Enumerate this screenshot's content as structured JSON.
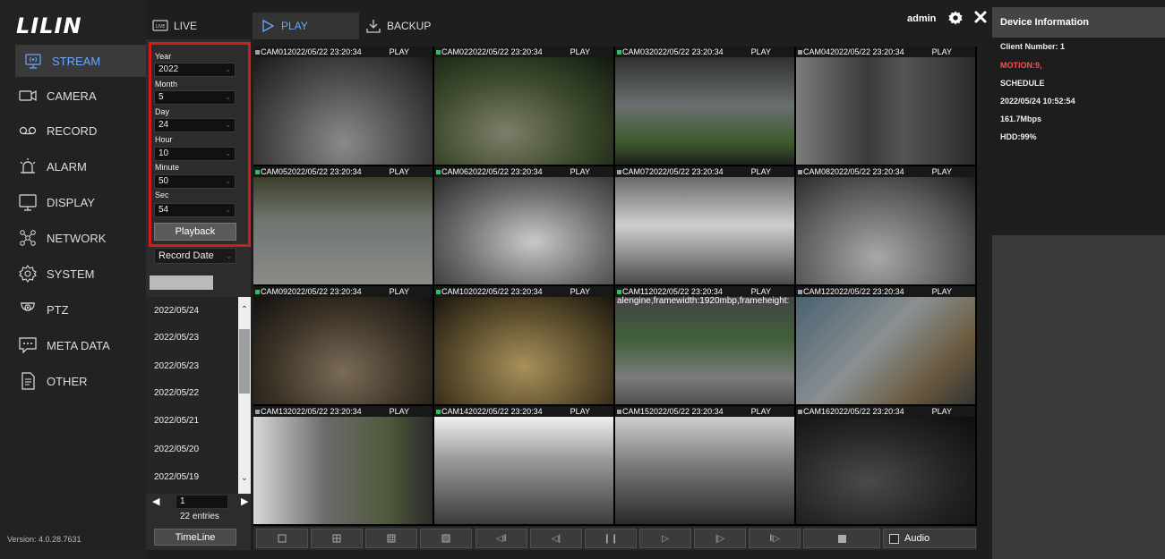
{
  "brand": {
    "logo": "LILIN"
  },
  "sidebar": {
    "items": [
      {
        "label": "STREAM",
        "icon": "stream-icon",
        "active": true
      },
      {
        "label": "CAMERA",
        "icon": "camera-icon"
      },
      {
        "label": "RECORD",
        "icon": "record-icon"
      },
      {
        "label": "ALARM",
        "icon": "alarm-icon"
      },
      {
        "label": "DISPLAY",
        "icon": "display-icon"
      },
      {
        "label": "NETWORK",
        "icon": "network-icon"
      },
      {
        "label": "SYSTEM",
        "icon": "system-icon"
      },
      {
        "label": "PTZ",
        "icon": "ptz-icon"
      },
      {
        "label": "META DATA",
        "icon": "metadata-icon"
      },
      {
        "label": "OTHER",
        "icon": "other-icon"
      }
    ],
    "version": "Version: 4.0.28.7631"
  },
  "tabs": {
    "live": "LIVE",
    "play": "PLAY",
    "backup": "BACKUP"
  },
  "header": {
    "user": "admin"
  },
  "search": {
    "year_label": "Year",
    "year": "2022",
    "month_label": "Month",
    "month": "5",
    "day_label": "Day",
    "day": "24",
    "hour_label": "Hour",
    "hour": "10",
    "minute_label": "Minute",
    "minute": "50",
    "sec_label": "Sec",
    "sec": "54",
    "playback": "Playback",
    "record_mode": "Record Date"
  },
  "date_list": [
    "2022/05/24",
    "2022/05/23",
    "2022/05/23",
    "2022/05/22",
    "2022/05/21",
    "2022/05/20",
    "2022/05/19"
  ],
  "pager": {
    "page": "1",
    "entries": "22 entries"
  },
  "timeline": "TimeLine",
  "cameras": [
    {
      "title": "CAM012022/05/22 23:20:34",
      "status": "PLAY",
      "active": false
    },
    {
      "title": "CAM022022/05/22 23:20:34",
      "status": "PLAY",
      "active": true
    },
    {
      "title": "CAM032022/05/22 23:20:34",
      "status": "PLAY",
      "active": true
    },
    {
      "title": "CAM042022/05/22 23:20:34",
      "status": "PLAY",
      "active": false
    },
    {
      "title": "CAM052022/05/22 23:20:34",
      "status": "PLAY",
      "active": true
    },
    {
      "title": "CAM062022/05/22 23:20:34",
      "status": "PLAY",
      "active": true
    },
    {
      "title": "CAM072022/05/22 23:20:34",
      "status": "PLAY",
      "active": false
    },
    {
      "title": "CAM082022/05/22 23:20:34",
      "status": "PLAY",
      "active": false
    },
    {
      "title": "CAM092022/05/22 23:20:34",
      "status": "PLAY",
      "active": true
    },
    {
      "title": "CAM102022/05/22 23:20:34",
      "status": "PLAY",
      "active": true
    },
    {
      "title": "CAM112022/05/22 23:20:34",
      "status": "PLAY",
      "active": true
    },
    {
      "title": "CAM122022/05/22 23:20:34",
      "status": "PLAY",
      "active": false
    },
    {
      "title": "CAM132022/05/22 23:20:34",
      "status": "PLAY",
      "active": false
    },
    {
      "title": "CAM142022/05/22 23:20:34",
      "status": "PLAY",
      "active": true
    },
    {
      "title": "CAM152022/05/22 23:20:34",
      "status": "PLAY",
      "active": false
    },
    {
      "title": "CAM162022/05/22 23:20:34",
      "status": "PLAY",
      "active": false
    }
  ],
  "cam11_note": "alengine,framewidth:1920mbp,frameheight:",
  "controls": {
    "audio": "Audio"
  },
  "device_info": {
    "title": "Device Information",
    "client": "Client Number: 1",
    "motion": "MOTION:9,",
    "schedule": "SCHEDULE",
    "datetime": "2022/05/24 10:52:54",
    "bitrate": "161.7Mbps",
    "hdd": "HDD:99%"
  },
  "colors": {
    "accent": "#6aa6ff",
    "highlight": "#d41b1b",
    "active_dot": "#22c55e",
    "inactive_dot": "#9ca3af",
    "motion": "#ff4d4d"
  }
}
